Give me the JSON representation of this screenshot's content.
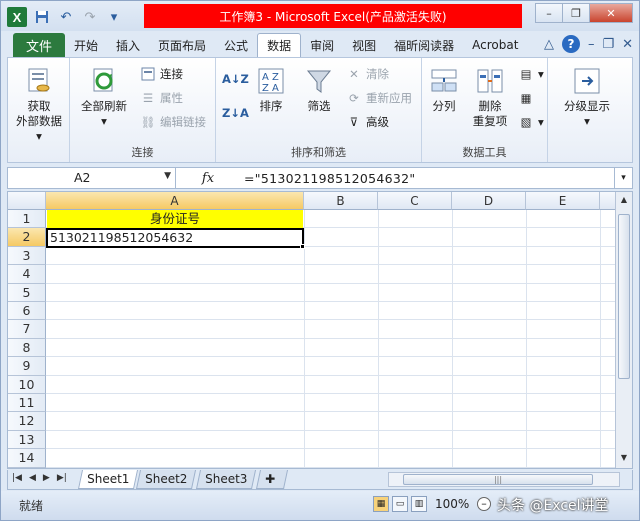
{
  "title": "工作簿3 - Microsoft Excel(产品激活失败)",
  "title_bar_color": "#ff0000",
  "quick_access": [
    "excel-logo",
    "save-icon",
    "undo-icon",
    "redo-icon",
    "customize-icon"
  ],
  "window_buttons": {
    "minimize": "–",
    "restore": "❐",
    "close": "✕"
  },
  "tabs": {
    "file": "文件",
    "items": [
      "开始",
      "插入",
      "页面布局",
      "公式",
      "数据",
      "审阅",
      "视图",
      "福昕阅读器",
      "Acrobat"
    ],
    "active": "数据"
  },
  "ribbon": {
    "get_external": {
      "line1": "获取",
      "line2": "外部数据 ▾"
    },
    "refresh_all": {
      "line1": "全部刷新",
      "line2": "▾"
    },
    "connections": "连接",
    "properties": "属性",
    "edit_links": "编辑链接",
    "group_connect": "连接",
    "sort_az": "A↓Z",
    "sort_za": "Z↓A",
    "sort": "排序",
    "filter": "筛选",
    "clear": "清除",
    "reapply": "重新应用",
    "advanced": "高级",
    "group_sort_filter": "排序和筛选",
    "text_to_columns": "分列",
    "remove_duplicates": {
      "line1": "删除",
      "line2": "重复项"
    },
    "group_data_tools": "数据工具",
    "outline": "分级显示"
  },
  "formula_bar": {
    "name_box": "A2",
    "fx": "fx",
    "formula": "=\"513021198512054632\""
  },
  "columns": [
    "A",
    "B",
    "C",
    "D",
    "E"
  ],
  "rows": [
    "1",
    "2",
    "3",
    "4",
    "5",
    "6",
    "7",
    "8",
    "9",
    "10",
    "11",
    "12",
    "13",
    "14"
  ],
  "cells": {
    "A1": "身份证号",
    "A2": "513021198512054632"
  },
  "sheet_tabs": [
    "Sheet1",
    "Sheet2",
    "Sheet3"
  ],
  "active_sheet": "Sheet1",
  "status": {
    "ready": "就绪",
    "zoom": "100%",
    "watermark": "头条 @Excel讲堂"
  },
  "colors": {
    "header_fill": "#ffff00",
    "file_tab": "#2c7a3e",
    "selection_header": "#f5c964"
  }
}
